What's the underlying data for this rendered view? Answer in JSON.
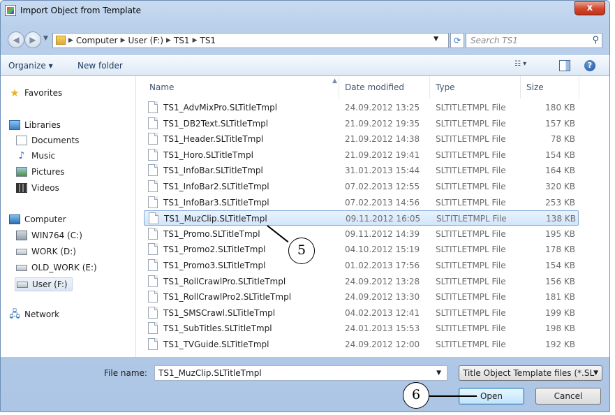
{
  "window": {
    "title": "Import Object from Template",
    "close_label": "x"
  },
  "address": {
    "crumbs": [
      "Computer",
      "User (F:)",
      "TS1",
      "TS1"
    ],
    "search_placeholder": "Search TS1"
  },
  "toolbar": {
    "organize_label": "Organize ▾",
    "new_folder_label": "New folder"
  },
  "sidebar": {
    "favorites": "Favorites",
    "libraries": "Libraries",
    "library_items": [
      "Documents",
      "Music",
      "Pictures",
      "Videos"
    ],
    "computer": "Computer",
    "drives": [
      "WIN764 (C:)",
      "WORK (D:)",
      "OLD_WORK (E:)",
      "User (F:)"
    ],
    "network": "Network"
  },
  "columns": {
    "name": "Name",
    "date": "Date modified",
    "type": "Type",
    "size": "Size"
  },
  "files": [
    {
      "name": "TS1_AdvMixPro.SLTitleTmpl",
      "date": "24.09.2012 13:25",
      "type": "SLTITLETMPL File",
      "size": "180 KB"
    },
    {
      "name": "TS1_DB2Text.SLTitleTmpl",
      "date": "21.09.2012 19:35",
      "type": "SLTITLETMPL File",
      "size": "157 KB"
    },
    {
      "name": "TS1_Header.SLTitleTmpl",
      "date": "21.09.2012 14:38",
      "type": "SLTITLETMPL File",
      "size": "78 KB"
    },
    {
      "name": "TS1_Horo.SLTitleTmpl",
      "date": "21.09.2012 19:41",
      "type": "SLTITLETMPL File",
      "size": "154 KB"
    },
    {
      "name": "TS1_InfoBar.SLTitleTmpl",
      "date": "31.01.2013 15:44",
      "type": "SLTITLETMPL File",
      "size": "164 KB"
    },
    {
      "name": "TS1_InfoBar2.SLTitleTmpl",
      "date": "07.02.2013 12:55",
      "type": "SLTITLETMPL File",
      "size": "320 KB"
    },
    {
      "name": "TS1_InfoBar3.SLTitleTmpl",
      "date": "07.02.2013 14:56",
      "type": "SLTITLETMPL File",
      "size": "253 KB"
    },
    {
      "name": "TS1_MuzClip.SLTitleTmpl",
      "date": "09.11.2012 16:05",
      "type": "SLTITLETMPL File",
      "size": "138 KB"
    },
    {
      "name": "TS1_Promo.SLTitleTmpl",
      "date": "09.11.2012 14:39",
      "type": "SLTITLETMPL File",
      "size": "195 KB"
    },
    {
      "name": "TS1_Promo2.SLTitleTmpl",
      "date": "04.10.2012 15:19",
      "type": "SLTITLETMPL File",
      "size": "178 KB"
    },
    {
      "name": "TS1_Promo3.SLTitleTmpl",
      "date": "01.02.2013 17:56",
      "type": "SLTITLETMPL File",
      "size": "154 KB"
    },
    {
      "name": "TS1_RollCrawlPro.SLTitleTmpl",
      "date": "24.09.2012 13:28",
      "type": "SLTITLETMPL File",
      "size": "156 KB"
    },
    {
      "name": "TS1_RollCrawlPro2.SLTitleTmpl",
      "date": "24.09.2012 13:30",
      "type": "SLTITLETMPL File",
      "size": "181 KB"
    },
    {
      "name": "TS1_SMSCrawl.SLTitleTmpl",
      "date": "04.02.2013 12:41",
      "type": "SLTITLETMPL File",
      "size": "199 KB"
    },
    {
      "name": "TS1_SubTitles.SLTitleTmpl",
      "date": "24.01.2013 15:53",
      "type": "SLTITLETMPL File",
      "size": "198 KB"
    },
    {
      "name": "TS1_TVGuide.SLTitleTmpl",
      "date": "24.09.2012 12:00",
      "type": "SLTITLETMPL File",
      "size": "192 KB"
    }
  ],
  "selected_index": 7,
  "footer": {
    "file_name_label": "File name:",
    "file_name_value": "TS1_MuzClip.SLTitleTmpl",
    "filter_value": "Title Object Template files (*.SL",
    "open_label": "Open",
    "cancel_label": "Cancel"
  },
  "callouts": {
    "five": "5",
    "six": "6"
  }
}
